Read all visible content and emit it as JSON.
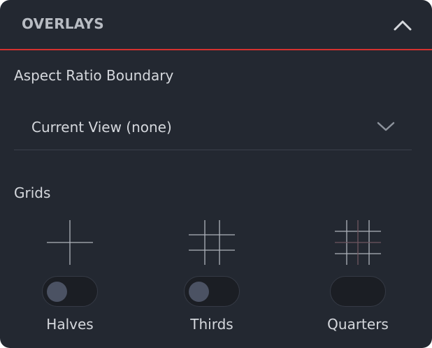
{
  "header": {
    "title": "OVERLAYS",
    "collapse_icon": "chevron-up-icon"
  },
  "aspect_ratio": {
    "label": "Aspect Ratio Boundary",
    "selected": "Current View (none)",
    "chevron_icon": "chevron-down-icon"
  },
  "grids": {
    "label": "Grids",
    "options": [
      {
        "label": "Halves",
        "icon": "halves-grid-icon",
        "enabled": false
      },
      {
        "label": "Thirds",
        "icon": "thirds-grid-icon",
        "enabled": false
      },
      {
        "label": "Quarters",
        "icon": "quarters-grid-icon",
        "enabled": false
      }
    ]
  },
  "colors": {
    "panel_background": "#232831",
    "accent_red": "#d6322f",
    "text": "#d5d8dd",
    "header_text": "#b8bcc3",
    "grid_lines": "#aeb3bb"
  }
}
